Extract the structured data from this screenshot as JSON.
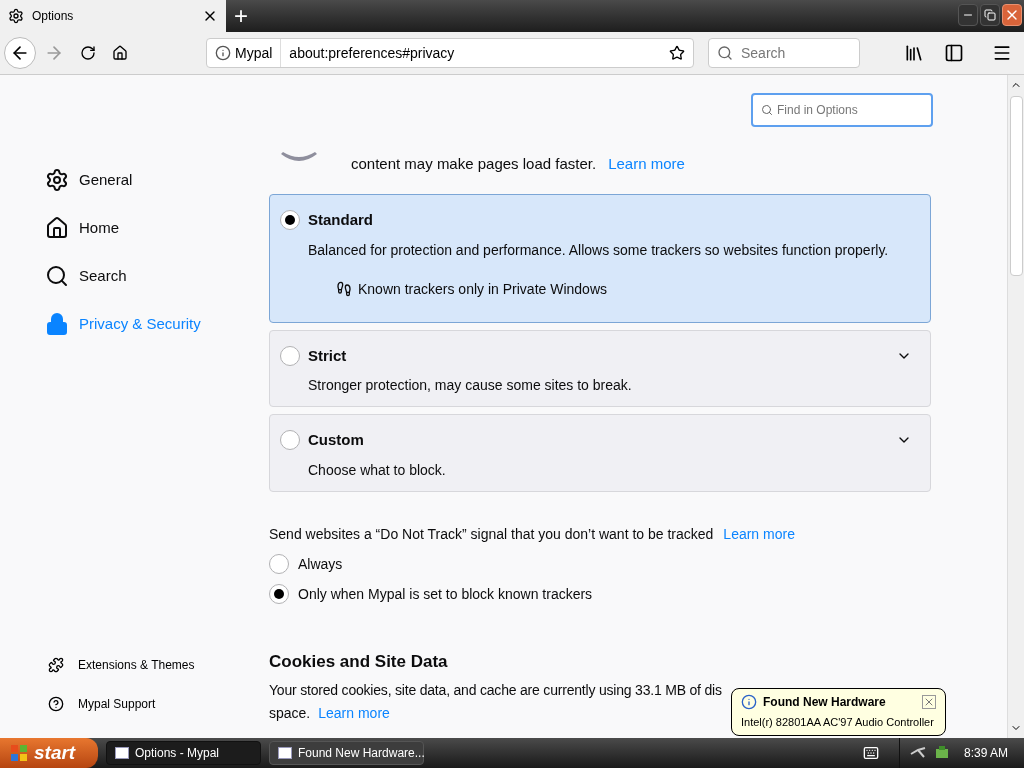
{
  "browser_tab": {
    "title": "Options",
    "selected": true
  },
  "new_tab_button": "+",
  "address_bar": {
    "identity": "Mypal",
    "url": "about:preferences#privacy"
  },
  "search_bar": {
    "placeholder": "Search"
  },
  "find_in_options": {
    "placeholder": "Find in Options"
  },
  "sidebar": {
    "items": [
      {
        "label": "General",
        "kind": "gear",
        "selected": false
      },
      {
        "label": "Home",
        "kind": "home",
        "selected": false
      },
      {
        "label": "Search",
        "kind": "search",
        "selected": false
      },
      {
        "label": "Privacy & Security",
        "kind": "lock",
        "selected": true
      }
    ],
    "footer_items": [
      {
        "label": "Extensions & Themes",
        "kind": "puzzle"
      },
      {
        "label": "Mypal Support",
        "kind": "help"
      }
    ]
  },
  "content_blocking": {
    "intro_text": "content may make pages load faster.",
    "intro_link": "Learn more",
    "options": [
      {
        "title": "Standard",
        "description": "Balanced for protection and performance. Allows some trackers so websites function properly.",
        "detail": "Known trackers only in Private Windows",
        "selected": true,
        "expanded": true
      },
      {
        "title": "Strict",
        "description": "Stronger protection, may cause some sites to break.",
        "selected": false,
        "expanded": false
      },
      {
        "title": "Custom",
        "description": "Choose what to block.",
        "selected": false,
        "expanded": false
      }
    ]
  },
  "do_not_track": {
    "label": "Send websites a “Do Not Track” signal that you don’t want to be tracked",
    "link": "Learn more",
    "options": [
      {
        "label": "Always",
        "selected": false
      },
      {
        "label": "Only when Mypal is set to block known trackers",
        "selected": true
      }
    ]
  },
  "cookies": {
    "heading": "Cookies and Site Data",
    "text": "Your stored cookies, site data, and cache are currently using 33.1 MB of dis",
    "text_2": "space.",
    "link": "Learn more"
  },
  "notification": {
    "title": "Found New Hardware",
    "message": "Intel(r) 82801AA AC'97 Audio Controller"
  },
  "taskbar": {
    "start": "start",
    "windows": [
      {
        "label": "Options - Mypal",
        "selected": true
      },
      {
        "label": "Found New Hardware...",
        "selected": false
      }
    ],
    "clock": "8:39 AM"
  }
}
